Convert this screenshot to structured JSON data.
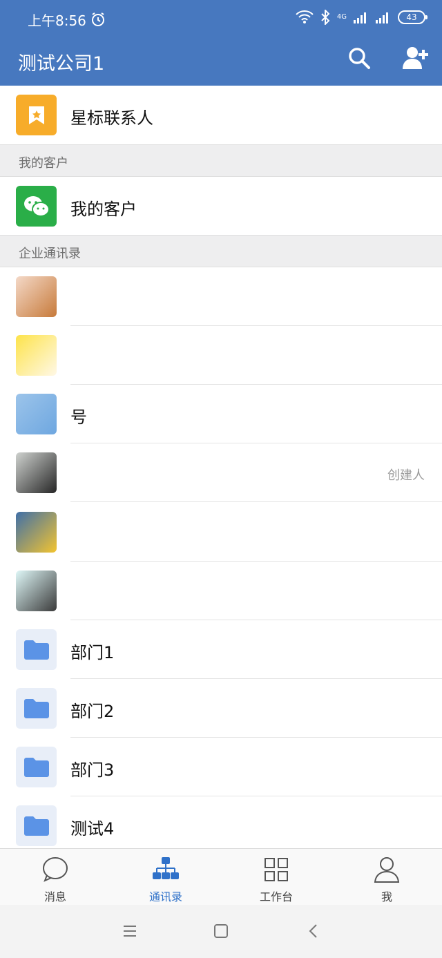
{
  "status": {
    "time": "上午8:56",
    "network": "4G",
    "battery": "43"
  },
  "header": {
    "title": "测试公司1"
  },
  "starred": {
    "label": "星标联系人"
  },
  "customers": {
    "section_title": "我的客户",
    "item_label": "我的客户"
  },
  "directory": {
    "section_title": "企业通讯录",
    "contacts": [
      {
        "label": "",
        "meta": ""
      },
      {
        "label": "",
        "meta": ""
      },
      {
        "label": "号",
        "meta": ""
      },
      {
        "label": "",
        "meta": "创建人"
      },
      {
        "label": "",
        "meta": ""
      },
      {
        "label": "",
        "meta": ""
      }
    ],
    "departments": [
      {
        "label": "部门1"
      },
      {
        "label": "部门2"
      },
      {
        "label": "部门3"
      },
      {
        "label": "测试4"
      }
    ]
  },
  "tabs": [
    {
      "label": "消息",
      "icon": "chat-icon",
      "active": false
    },
    {
      "label": "通讯录",
      "icon": "org-chart-icon",
      "active": true
    },
    {
      "label": "工作台",
      "icon": "grid-icon",
      "active": false
    },
    {
      "label": "我",
      "icon": "person-icon",
      "active": false
    }
  ],
  "colors": {
    "brand": "#4778bf",
    "active_tab": "#2f71c9",
    "starred_bg": "#f7ac2a",
    "wechat_green": "#2aae48",
    "folder_blue": "#5b93e6",
    "folder_bg": "#e8eef8"
  }
}
